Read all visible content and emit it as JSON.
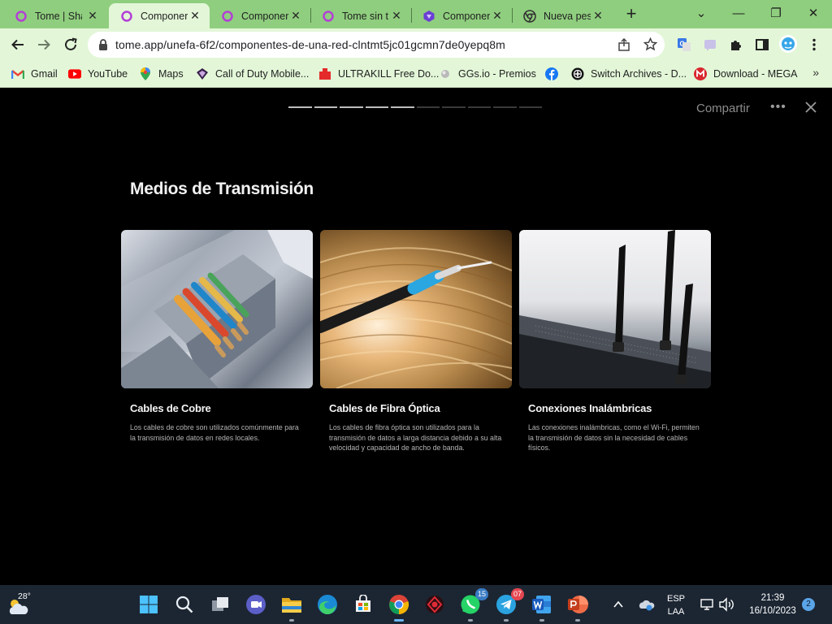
{
  "browser": {
    "tabs": [
      {
        "title": "Tome | Sha",
        "close": "✕",
        "active": false
      },
      {
        "title": "Componer",
        "close": "✕",
        "active": true
      },
      {
        "title": "Componer",
        "close": "✕",
        "active": false
      },
      {
        "title": "Tome sin t",
        "close": "✕",
        "active": false
      },
      {
        "title": "Componer",
        "close": "✕",
        "active": false
      },
      {
        "title": "Nueva pes",
        "close": "✕",
        "active": false
      }
    ],
    "new_tab": "+",
    "window_controls": {
      "minimize": "—",
      "restore": "❐",
      "close": "✕",
      "chevron": "⌄"
    },
    "url": "tome.app/unefa-6f2/componentes-de-una-red-clntmt5jc01gcmn7de0yepq8m",
    "bookmarks": [
      {
        "label": "Gmail",
        "icon": "gmail-icon"
      },
      {
        "label": "YouTube",
        "icon": "youtube-icon"
      },
      {
        "label": "Maps",
        "icon": "maps-icon"
      },
      {
        "label": "Call of Duty Mobile...",
        "icon": "cod-icon"
      },
      {
        "label": "ULTRAKILL Free Do...",
        "icon": "ultrakill-icon"
      },
      {
        "label": "GGs.io - Premios",
        "icon": "ggs-icon"
      },
      {
        "label": "",
        "icon": "facebook-icon"
      },
      {
        "label": "Switch Archives - D...",
        "icon": "switch-archives-icon"
      },
      {
        "label": "Download - MEGA",
        "icon": "mega-icon"
      }
    ],
    "bookmarks_more": "»"
  },
  "presentation": {
    "share_label": "Compartir",
    "more_label": "•••",
    "progress": {
      "total": 10,
      "completed": 5
    },
    "title": "Medios de Transmisión",
    "cards": [
      {
        "title": "Cables de Cobre",
        "description": "Los cables de cobre son utilizados comúnmente para la transmisión de datos en redes locales.",
        "image": "copper-cables-image"
      },
      {
        "title": "Cables de Fibra Óptica",
        "description": "Los cables de fibra óptica son utilizados para la transmisión de datos a larga distancia debido a su alta velocidad y capacidad de ancho de banda.",
        "image": "fiber-optic-image"
      },
      {
        "title": "Conexiones Inalámbricas",
        "description": "Las conexiones inalámbricas, como el Wi-Fi, permiten la transmisión de datos sin la necesidad de cables físicos.",
        "image": "wireless-router-image"
      }
    ]
  },
  "taskbar": {
    "weather_temp": "28°",
    "apps": [
      {
        "name": "start",
        "badge": ""
      },
      {
        "name": "search",
        "badge": ""
      },
      {
        "name": "task-view",
        "badge": ""
      },
      {
        "name": "meet",
        "badge": ""
      },
      {
        "name": "file-explorer",
        "badge": ""
      },
      {
        "name": "edge",
        "badge": ""
      },
      {
        "name": "store",
        "badge": ""
      },
      {
        "name": "chrome",
        "badge": ""
      },
      {
        "name": "game",
        "badge": ""
      },
      {
        "name": "whatsapp",
        "badge": "15"
      },
      {
        "name": "telegram",
        "badge": "07"
      },
      {
        "name": "word",
        "badge": ""
      },
      {
        "name": "powerpoint",
        "badge": ""
      }
    ],
    "language": "ESP",
    "layout": "LAA",
    "time": "21:39",
    "date": "16/10/2023",
    "notifications": "2"
  }
}
